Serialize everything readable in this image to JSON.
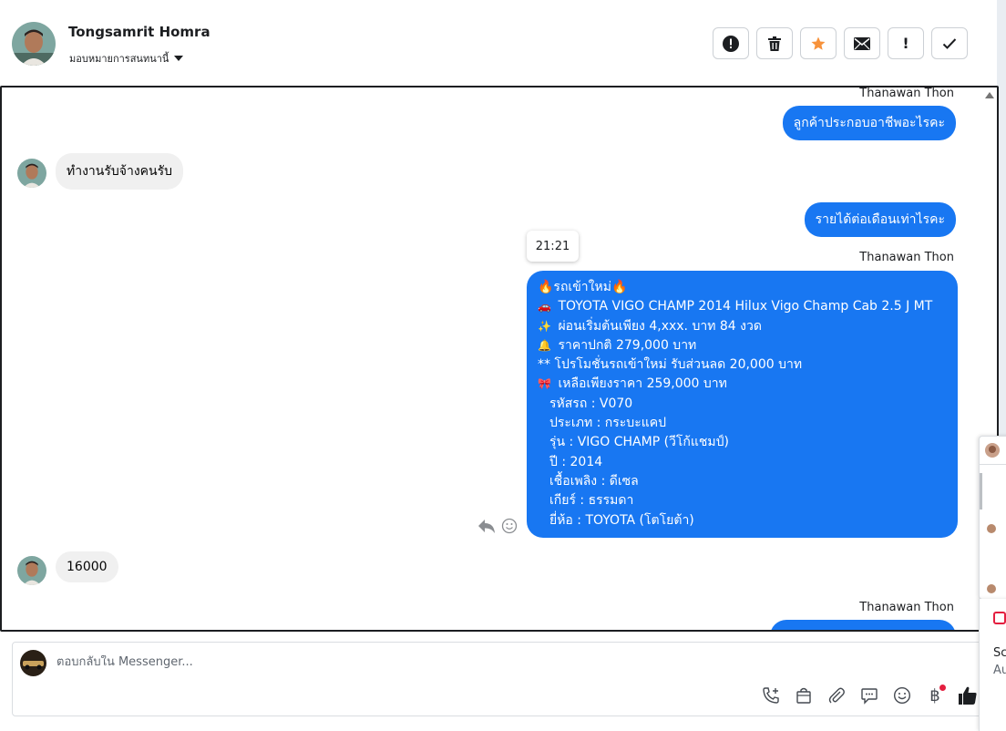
{
  "header": {
    "contact_name": "Tongsamrit Homra",
    "assign_label": "มอบหมายการสนทนานี้",
    "toolbar": [
      {
        "name": "alert-icon-button",
        "glyph": "!",
        "active": false
      },
      {
        "name": "trash-icon-button",
        "glyph": "🗑",
        "active": false
      },
      {
        "name": "star-icon-button",
        "glyph": "★",
        "active": true
      },
      {
        "name": "mail-icon-button",
        "glyph": "✉",
        "active": false
      },
      {
        "name": "mark-important-button",
        "glyph": "!",
        "active": false
      },
      {
        "name": "done-check-button",
        "glyph": "✓",
        "active": false
      }
    ]
  },
  "chat": {
    "messages": [
      {
        "sender": "Thanawan Thon",
        "text": "ลูกค้าประกอบอาชีพอะไรคะ"
      },
      {
        "text": "ทำงานรับจ้างคนรับ"
      },
      {
        "text": "รายได้ต่อเดือนเท่าไรคะ"
      },
      {
        "time": "21:21",
        "sender": "Thanawan Thon"
      },
      {
        "text": "16000"
      },
      {
        "sender": "Thanawan Thon"
      }
    ],
    "car_listing": {
      "lines": [
        {
          "emoji": "",
          "text": "🔥รถเข้าใหม่🔥",
          "indent": false
        },
        {
          "emoji": "🚗",
          "text": "TOYOTA VIGO CHAMP 2014 Hilux Vigo Champ Cab 2.5 J MT",
          "indent": false
        },
        {
          "emoji": "✨",
          "text": "ผ่อนเริ่มต้นเพียง 4,xxx. บาท 84 งวด",
          "indent": false
        },
        {
          "emoji": "🔔",
          "text": "ราคาปกติ 279,000 บาท",
          "indent": false
        },
        {
          "emoji": "",
          "text": "** โปรโมชั่นรถเข้าใหม่ รับส่วนลด 20,000 บาท",
          "indent": false
        },
        {
          "emoji": "🎀",
          "text": "เหลือเพียงราคา 259,000 บาท",
          "indent": false
        },
        {
          "emoji": "",
          "text": "รหัสรถ : V070",
          "indent": true
        },
        {
          "emoji": "",
          "text": "ประเภท : กระบะแคป",
          "indent": true
        },
        {
          "emoji": "",
          "text": "รุ่น : VIGO CHAMP (วีโก้แชมป์)",
          "indent": true
        },
        {
          "emoji": "",
          "text": "ปี : 2014",
          "indent": true
        },
        {
          "emoji": "",
          "text": "เชื้อเพลิง : ดีเซล",
          "indent": true
        },
        {
          "emoji": "",
          "text": "เกียร์ : ธรรมดา",
          "indent": true
        },
        {
          "emoji": "",
          "text": "ยี่ห้อ : TOYOTA (โตโยต้า)",
          "indent": true
        }
      ]
    }
  },
  "composer": {
    "placeholder": "ตอบกลับใน Messenger...",
    "currency_symbol": "฿"
  },
  "side": {
    "line1": "Sc",
    "line2": "Au"
  },
  "colors": {
    "accent": "#1877f2",
    "star": "#f7923b",
    "incoming_bubble": "#f0f0f0"
  }
}
